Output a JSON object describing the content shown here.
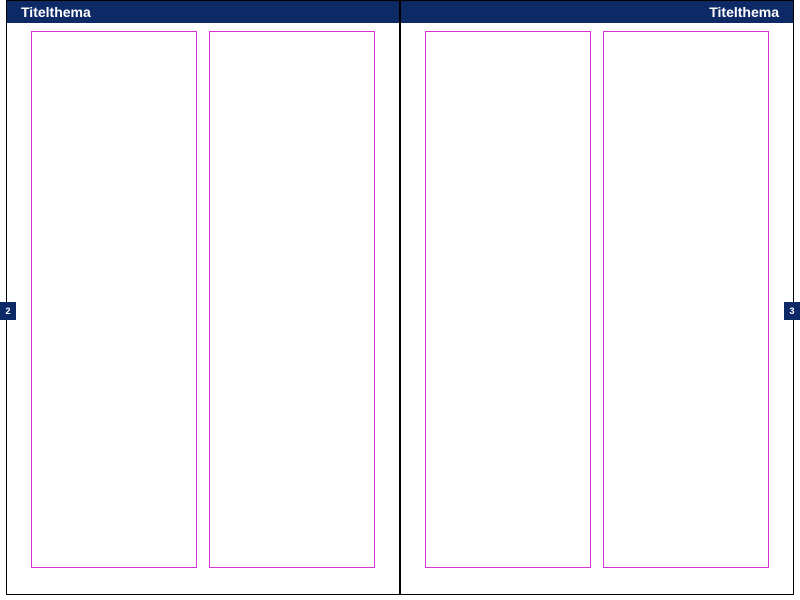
{
  "header": {
    "left_title": "Titelthema",
    "right_title": "Titelthema"
  },
  "pages": {
    "left_number": "2",
    "right_number": "3"
  },
  "colors": {
    "header_bg": "#0d2a66",
    "guide": "#d633d6"
  }
}
